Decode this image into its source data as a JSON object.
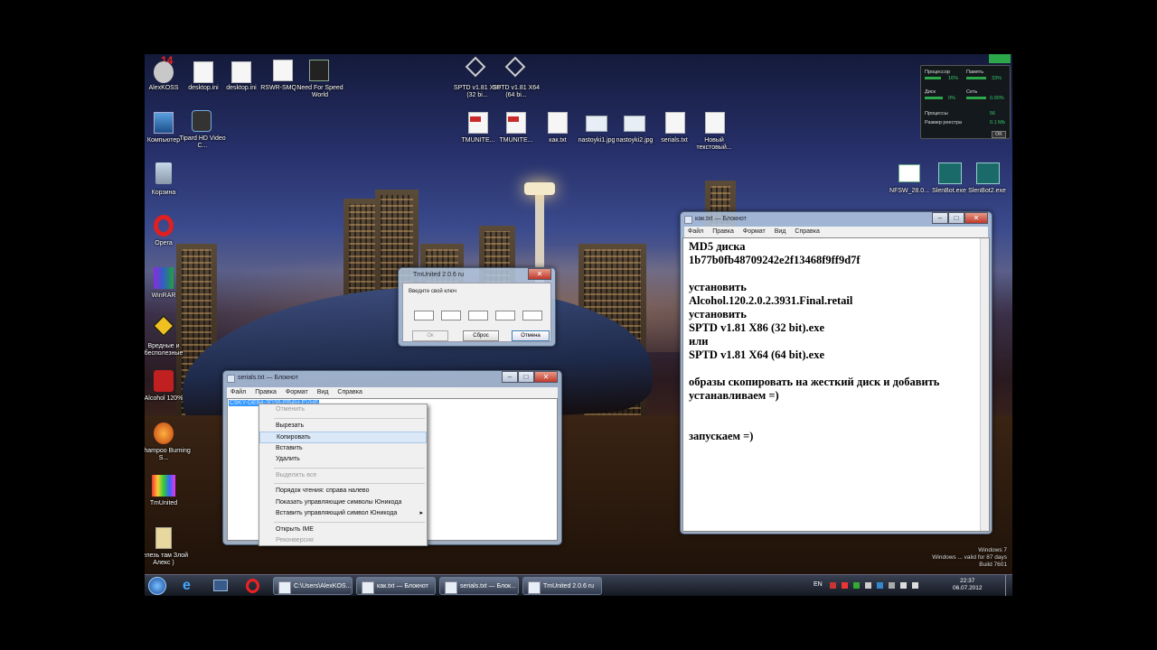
{
  "desktop_icons": [
    {
      "label": "AlexKOSS",
      "x": 0,
      "y": 0
    },
    {
      "label": "desktop.ini"
    },
    {
      "label": "desktop.ini"
    },
    {
      "label": "RSWR-SMQ..."
    },
    {
      "label": "Need For Speed World"
    },
    {
      "label": "SPTD v1.81 X86 (32 bi..."
    },
    {
      "label": "SPTD v1.81 X64 (64 bi..."
    },
    {
      "label": "Компьютер"
    },
    {
      "label": "Tipard HD Video C..."
    },
    {
      "label": "TMUNITE..."
    },
    {
      "label": "TMUNITE..."
    },
    {
      "label": "как.txt"
    },
    {
      "label": "nastoyki1.jpg"
    },
    {
      "label": "nastoyki2.jpg"
    },
    {
      "label": "serials.txt"
    },
    {
      "label": "Новый текстовый..."
    },
    {
      "label": "Корзина"
    },
    {
      "label": "Opera"
    },
    {
      "label": "WinRAR"
    },
    {
      "label": "Вредные и бесполезные"
    },
    {
      "label": "Alcohol 120%"
    },
    {
      "label": "Ashampoo Burning S..."
    },
    {
      "label": "TmUnited"
    },
    {
      "label": "нелезь там Злой Алекс )"
    },
    {
      "label": "NFSW_28.0..."
    },
    {
      "label": "SlenBot.exe"
    },
    {
      "label": "SlenBot2.exe"
    }
  ],
  "top_badge": "14",
  "gadget": {
    "cpu_label": "Процессор",
    "cpu_val": "16%",
    "mem_label": "Память",
    "mem_val": "33%",
    "disk_label": "Диск",
    "disk_val": "0%",
    "net_label": "Сеть",
    "net_val": "0.00%",
    "proc_label": "Процессы",
    "proc_val": "56",
    "reg_label": "Размер реестра",
    "reg_val": "0.1 Mb",
    "ok": "OK"
  },
  "tmunited_dialog": {
    "title": "TmUnited 2.0.6 ru",
    "prompt": "Введите свой ключ",
    "ok": "Ок",
    "reset": "Сброс",
    "cancel": "Отмена"
  },
  "notepad_serials": {
    "title": "serials.txt — Блокнот",
    "menu": [
      "Файл",
      "Правка",
      "Формат",
      "Вид",
      "Справка"
    ],
    "selected_text": "C9KY-DE84-3D38-PB4H-EVH6"
  },
  "context_menu": {
    "items": [
      {
        "label": "Отменить",
        "disabled": true
      },
      {
        "sep": true
      },
      {
        "label": "Вырезать"
      },
      {
        "label": "Копировать",
        "selected": true
      },
      {
        "label": "Вставить"
      },
      {
        "label": "Удалить"
      },
      {
        "sep": true
      },
      {
        "label": "Выделить все",
        "disabled": true
      },
      {
        "sep": true
      },
      {
        "label": "Порядок чтения: справа налево"
      },
      {
        "label": "Показать управляющие символы Юникода"
      },
      {
        "label": "Вставить управляющий символ Юникода",
        "submenu": true
      },
      {
        "sep": true
      },
      {
        "label": "Открыть IME"
      },
      {
        "label": "Реконверсия",
        "disabled": true
      }
    ]
  },
  "notepad_kak": {
    "title": "как.txt — Блокнот",
    "menu": [
      "Файл",
      "Правка",
      "Формат",
      "Вид",
      "Справка"
    ],
    "text": "MD5 диска\n1b77b0fb48709242e2f13468f9ff9d7f\n\nустановить\nAlcohol.120.2.0.2.3931.Final.retail\nустановить\nSPTD v1.81 X86 (32 bit).exe\nили\nSPTD v1.81 X64 (64 bit).exe\n\nобразы скопировать на жесткий диск и добавить\nустанавливаем =)\n\n\nзапускаем =)"
  },
  "watermark": {
    "line1": "Windows 7",
    "line2": "Windows ... valid for 87 days",
    "line3": "Build 7601"
  },
  "taskbar": {
    "buttons": [
      "C:\\Users\\AlexKOS...",
      "как.txt — Блокнот",
      "serials.txt — Блок...",
      "TmUnited 2.0.6 ru"
    ],
    "lang": "EN",
    "time": "22:37",
    "date": "06.07.2012"
  }
}
